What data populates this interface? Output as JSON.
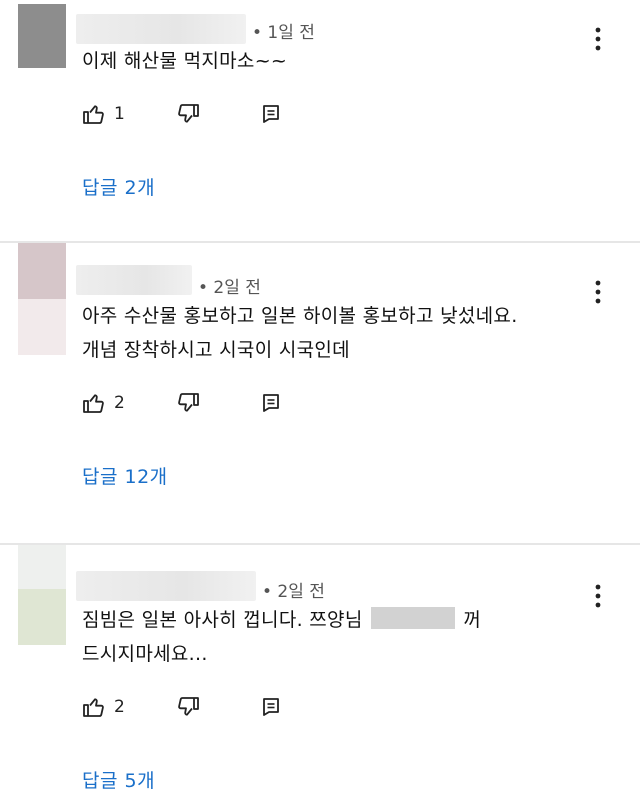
{
  "comments": [
    {
      "time": "• 1일 전",
      "lines": [
        "이제 해산물 먹지마소~~"
      ],
      "likes": "1",
      "reply_label": "답글 2개"
    },
    {
      "time": "• 2일 전",
      "lines": [
        "아주 수산물 홍보하고 일본 하이볼 홍보하고 낮섰네요.",
        "개념 장착하시고 시국이 시국인데"
      ],
      "likes": "2",
      "reply_label": "답글 12개"
    },
    {
      "time": "• 2일 전",
      "line1_before": "짐빔은 일본 아사히 껍니다. 쯔양님",
      "line1_after": "꺼",
      "line2": "드시지마세요...",
      "likes": "2",
      "reply_label": "답글 5개"
    }
  ],
  "icons": {
    "like": "thumbs-up-icon",
    "dislike": "thumbs-down-icon",
    "reply": "comment-icon",
    "more": "more-vertical-icon"
  },
  "colors": {
    "reply_link": "#1a6fc9"
  }
}
